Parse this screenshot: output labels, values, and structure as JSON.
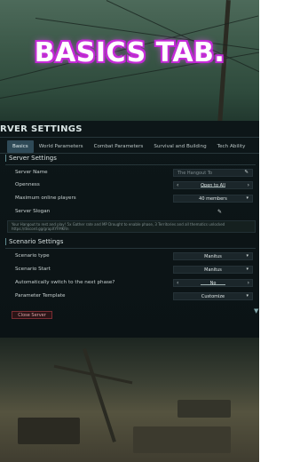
{
  "caption": "BASICS TAB.",
  "panel": {
    "title": "RVER SETTINGS"
  },
  "tabs": [
    {
      "label": "Basics",
      "active": true
    },
    {
      "label": "World Parameters",
      "active": false
    },
    {
      "label": "Combat Parameters",
      "active": false
    },
    {
      "label": "Survival and Building",
      "active": false
    },
    {
      "label": "Tech Ability",
      "active": false
    }
  ],
  "server_settings": {
    "title": "Server Settings",
    "server_name": {
      "label": "Server Name",
      "placeholder": "The Hangout To"
    },
    "openness": {
      "label": "Openness",
      "value": "Open to All"
    },
    "max_players": {
      "label": "Maximum online players",
      "value": "40 members"
    },
    "slogan": {
      "label": "Server Slogan",
      "text": "Your Hangout to rest and play! 5x Gather rate and MP Drought to enable phase, 3 Territories and all thematics unlocked https://discord.gg/grapXYFMKRn"
    }
  },
  "scenario_settings": {
    "title": "Scenario Settings",
    "scenario_type": {
      "label": "Scenario type",
      "value": "Manitus"
    },
    "scenario_start": {
      "label": "Scenario Start",
      "value": "Manitus"
    },
    "auto_switch": {
      "label": "Automatically switch to the next phase?",
      "value": "No"
    },
    "param_template": {
      "label": "Parameter Template",
      "value": "Customize"
    }
  },
  "close_button": "Close Server",
  "colors": {
    "accent": "#2f4a57",
    "caption_glow": "#c22ad6",
    "close_border": "#7a2d33"
  }
}
